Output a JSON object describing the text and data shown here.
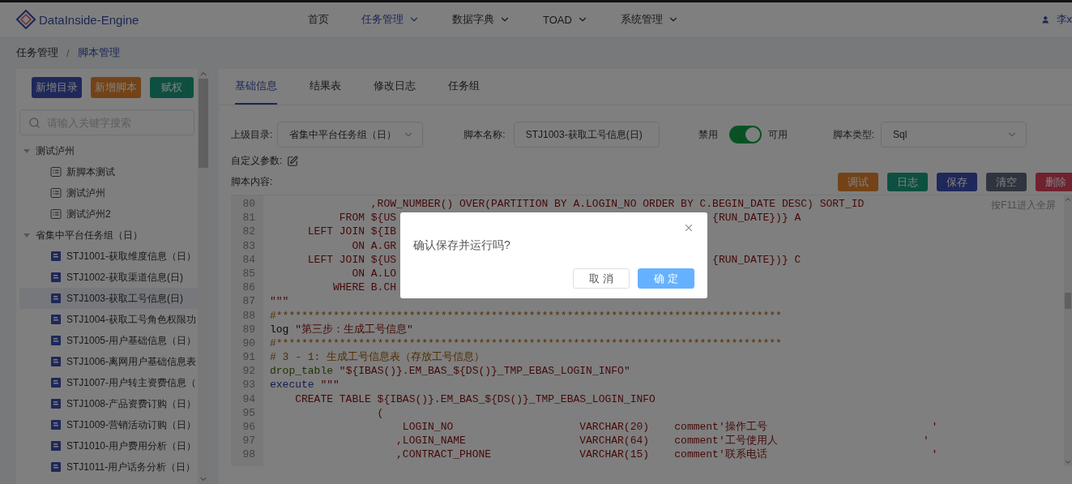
{
  "app": {
    "logo_text": "DataInside-Engine",
    "user": "李x"
  },
  "nav": [
    {
      "label": "首页",
      "selected": false,
      "has_menu": false
    },
    {
      "label": "任务管理",
      "selected": true,
      "has_menu": true
    },
    {
      "label": "数据字典",
      "selected": false,
      "has_menu": true
    },
    {
      "label": "TOAD",
      "selected": false,
      "has_menu": true
    },
    {
      "label": "系统管理",
      "selected": false,
      "has_menu": true
    }
  ],
  "breadcrumb": {
    "separator": "/",
    "items": [
      "任务管理",
      "脚本管理"
    ]
  },
  "sidebar": {
    "buttons": [
      {
        "label": "新增目录",
        "kind": "primary"
      },
      {
        "label": "新增脚本",
        "kind": "warning"
      },
      {
        "label": "赋权",
        "kind": "success"
      }
    ],
    "search": {
      "placeholder": "请输入关键字搜索"
    },
    "tree": [
      {
        "label": "测试泸州",
        "expanded": true,
        "children": [
          {
            "label": "新脚本测试",
            "kind": "doc",
            "selected": false
          },
          {
            "label": "测试泸州",
            "kind": "doc",
            "selected": false
          },
          {
            "label": "测试泸州2",
            "kind": "doc",
            "selected": false
          }
        ]
      },
      {
        "label": "省集中平台任务组（日）",
        "expanded": true,
        "children": [
          {
            "label": "STJ1001-获取维度信息（日）",
            "kind": "script",
            "selected": false
          },
          {
            "label": "STJ1002-获取渠道信息(日)",
            "kind": "script",
            "selected": false
          },
          {
            "label": "STJ1003-获取工号信息(日)",
            "kind": "script",
            "selected": true
          },
          {
            "label": "STJ1004-获取工号角色权限功",
            "kind": "script",
            "selected": false
          },
          {
            "label": "STJ1005-用户基础信息（日）",
            "kind": "script",
            "selected": false
          },
          {
            "label": "STJ1006-离网用户基础信息表",
            "kind": "script",
            "selected": false
          },
          {
            "label": "STJ1007-用户转主资费信息（",
            "kind": "script",
            "selected": false
          },
          {
            "label": "STJ1008-产品资费订购（日）",
            "kind": "script",
            "selected": false
          },
          {
            "label": "STJ1009-营销活动订购（日）",
            "kind": "script",
            "selected": false
          },
          {
            "label": "STJ1010-用户费用分析（日）",
            "kind": "script",
            "selected": false
          },
          {
            "label": "STJ1011-用户话务分析（日）",
            "kind": "script",
            "selected": false
          }
        ]
      }
    ]
  },
  "tabs": [
    {
      "label": "基础信息",
      "selected": true
    },
    {
      "label": "结果表",
      "selected": false
    },
    {
      "label": "修改日志",
      "selected": false
    },
    {
      "label": "任务组",
      "selected": false
    }
  ],
  "form": {
    "parent_label": "上级目录:",
    "parent_value": "省集中平台任务组（日）",
    "name_label": "脚本名称:",
    "name_value": "STJ1003-获取工号信息(日)",
    "switch_off_label": "禁用",
    "switch_on": true,
    "switch_on_label": "可用",
    "type_label": "脚本类型:",
    "type_value": "Sql",
    "params_label": "自定义参数:",
    "content_label": "脚本内容:"
  },
  "actions": [
    {
      "label": "调试",
      "kind": "warning"
    },
    {
      "label": "日志",
      "kind": "success"
    },
    {
      "label": "保存",
      "kind": "primary"
    },
    {
      "label": "清空",
      "kind": "info"
    },
    {
      "label": "删除",
      "kind": "danger"
    }
  ],
  "editor": {
    "hint": "按F11进入全屏",
    "lines": [
      {
        "number": "80",
        "segments": [
          {
            "kind": "sql",
            "text": "                ,ROW_NUMBER() OVER(PARTITION BY A.LOGIN_NO ORDER BY C.BEGIN_DATE DESC) SORT_ID"
          }
        ]
      },
      {
        "number": "81",
        "segments": [
          {
            "kind": "sql",
            "text": "           FROM ${US"
          }
        ],
        "tail": "{RUN_DATE})} A"
      },
      {
        "number": "82",
        "segments": [
          {
            "kind": "sql",
            "text": "      LEFT JOIN ${IB"
          }
        ]
      },
      {
        "number": "83",
        "segments": [
          {
            "kind": "sql",
            "text": "             ON A.GR"
          }
        ]
      },
      {
        "number": "84",
        "segments": [
          {
            "kind": "sql",
            "text": "      LEFT JOIN ${US"
          }
        ],
        "tail": "{RUN_DATE})} C"
      },
      {
        "number": "85",
        "segments": [
          {
            "kind": "sql",
            "text": "             ON A.LO"
          }
        ]
      },
      {
        "number": "86",
        "segments": [
          {
            "kind": "sql",
            "text": "          WHERE B.CH"
          }
        ]
      },
      {
        "number": "87",
        "segments": [
          {
            "kind": "sql",
            "text": "\"\"\""
          }
        ]
      },
      {
        "number": "88",
        "segments": [
          {
            "kind": "comment",
            "text": "#********************************************************************************"
          }
        ]
      },
      {
        "number": "89",
        "segments": [
          {
            "kind": "plain",
            "text": "log "
          },
          {
            "kind": "sql",
            "text": "\"第三步：生成工号信息\""
          }
        ]
      },
      {
        "number": "90",
        "segments": [
          {
            "kind": "comment",
            "text": "#********************************************************************************"
          }
        ]
      },
      {
        "number": "91",
        "segments": [
          {
            "kind": "comment",
            "text": "# 3 - 1: 生成工号信息表（存放工号信息）"
          }
        ]
      },
      {
        "number": "92",
        "segments": [
          {
            "kind": "builtin",
            "text": "drop_table "
          },
          {
            "kind": "sql",
            "text": "\"${IBAS()}.EM_BAS_${DS()}_TMP_EBAS_LOGIN_INFO\""
          }
        ]
      },
      {
        "number": "93",
        "segments": [
          {
            "kind": "keyword",
            "text": "execute "
          },
          {
            "kind": "sql",
            "text": "\"\"\""
          }
        ]
      },
      {
        "number": "94",
        "segments": [
          {
            "kind": "sql",
            "text": "    CREATE TABLE ${IBAS()}.EM_BAS_${DS()}_TMP_EBAS_LOGIN_INFO"
          }
        ]
      },
      {
        "number": "95",
        "segments": [
          {
            "kind": "sql",
            "text": "                 ("
          }
        ]
      },
      {
        "number": "96",
        "segments": [
          {
            "kind": "sql",
            "text": "                     LOGIN_NO                    VARCHAR(20)    comment'操作工号                          '"
          }
        ]
      },
      {
        "number": "97",
        "segments": [
          {
            "kind": "sql",
            "text": "                    ,LOGIN_NAME                  VARCHAR(64)    comment'工号使用人                       '"
          }
        ]
      },
      {
        "number": "98",
        "segments": [
          {
            "kind": "sql",
            "text": "                    ,CONTRACT_PHONE              VARCHAR(15)    comment'联系电话                          '"
          }
        ]
      }
    ]
  },
  "dialog": {
    "message": "确认保存并运行吗?",
    "buttons": [
      {
        "label": "取 消",
        "primary": false
      },
      {
        "label": "确 定",
        "primary": true
      }
    ]
  }
}
